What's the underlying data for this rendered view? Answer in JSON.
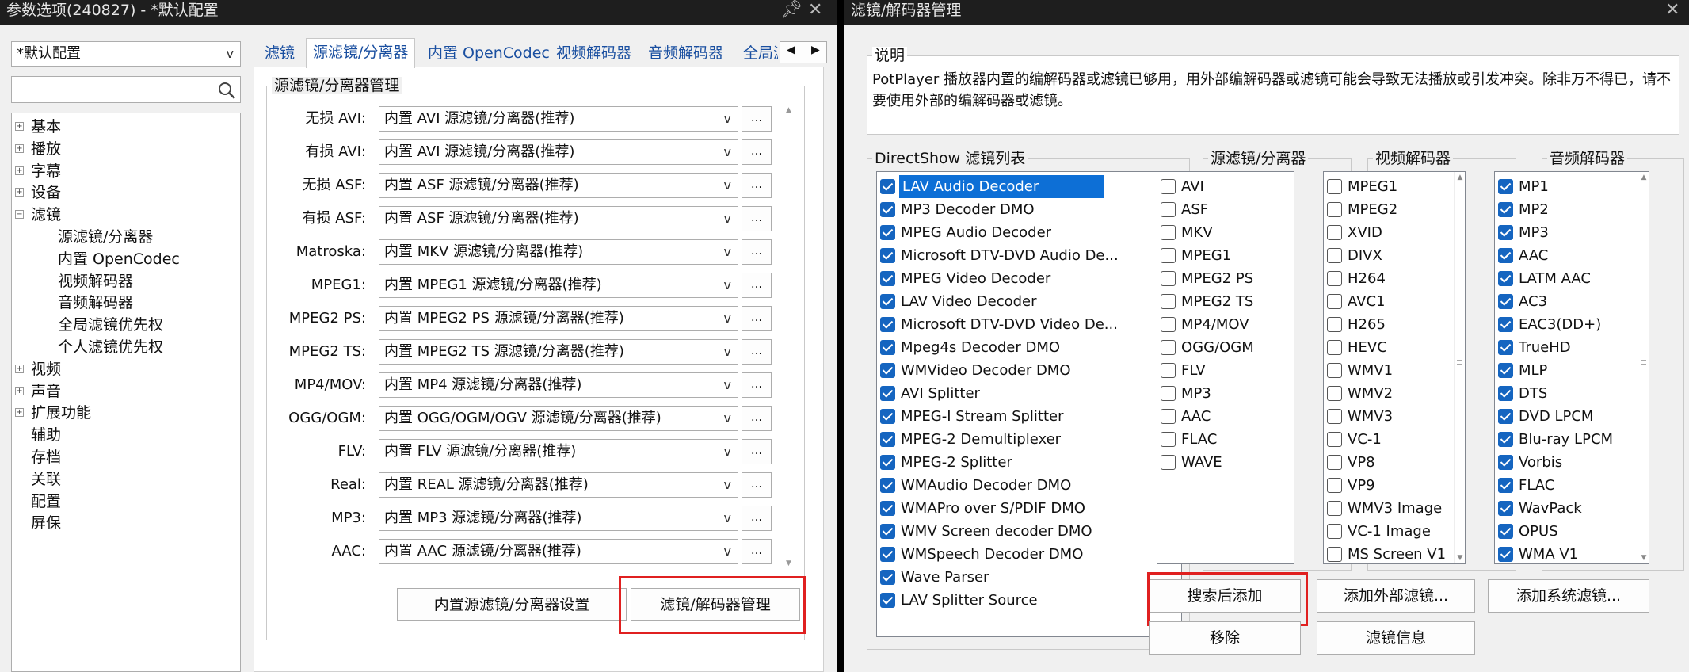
{
  "left_window": {
    "title": "参数选项(240827) - *默认配置",
    "profile_combo": "*默认配置",
    "search_placeholder": "",
    "tree": [
      {
        "label": "基本",
        "level": 0,
        "expander": "+"
      },
      {
        "label": "播放",
        "level": 0,
        "expander": "+"
      },
      {
        "label": "字幕",
        "level": 0,
        "expander": "+"
      },
      {
        "label": "设备",
        "level": 0,
        "expander": "+"
      },
      {
        "label": "滤镜",
        "level": 0,
        "expander": "−"
      },
      {
        "label": "源滤镜/分离器",
        "level": 1,
        "expander": ""
      },
      {
        "label": "内置 OpenCodec",
        "level": 1,
        "expander": ""
      },
      {
        "label": "视频解码器",
        "level": 1,
        "expander": ""
      },
      {
        "label": "音频解码器",
        "level": 1,
        "expander": ""
      },
      {
        "label": "全局滤镜优先权",
        "level": 1,
        "expander": ""
      },
      {
        "label": "个人滤镜优先权",
        "level": 1,
        "expander": ""
      },
      {
        "label": "视频",
        "level": 0,
        "expander": "+"
      },
      {
        "label": "声音",
        "level": 0,
        "expander": "+"
      },
      {
        "label": "扩展功能",
        "level": 0,
        "expander": "+"
      },
      {
        "label": "辅助",
        "level": 0,
        "expander": ""
      },
      {
        "label": "存档",
        "level": 0,
        "expander": ""
      },
      {
        "label": "关联",
        "level": 0,
        "expander": ""
      },
      {
        "label": "配置",
        "level": 0,
        "expander": ""
      },
      {
        "label": "屏保",
        "level": 0,
        "expander": ""
      }
    ],
    "tabs": [
      "滤镜",
      "源滤镜/分离器",
      "内置 OpenCodec",
      "视频解码器",
      "音频解码器",
      "全局滤"
    ],
    "active_tab": 1,
    "group_title": "源滤镜/分离器管理",
    "rows": [
      {
        "label": "无损 AVI:",
        "value": "内置 AVI 源滤镜/分离器(推荐)"
      },
      {
        "label": "有损 AVI:",
        "value": "内置 AVI 源滤镜/分离器(推荐)"
      },
      {
        "label": "无损 ASF:",
        "value": "内置 ASF 源滤镜/分离器(推荐)"
      },
      {
        "label": "有损 ASF:",
        "value": "内置 ASF 源滤镜/分离器(推荐)"
      },
      {
        "label": "Matroska:",
        "value": "内置 MKV 源滤镜/分离器(推荐)"
      },
      {
        "label": "MPEG1:",
        "value": "内置 MPEG1 源滤镜/分离器(推荐)"
      },
      {
        "label": "MPEG2 PS:",
        "value": "内置 MPEG2 PS 源滤镜/分离器(推荐)"
      },
      {
        "label": "MPEG2 TS:",
        "value": "内置 MPEG2 TS 源滤镜/分离器(推荐)"
      },
      {
        "label": "MP4/MOV:",
        "value": "内置 MP4 源滤镜/分离器(推荐)"
      },
      {
        "label": "OGG/OGM:",
        "value": "内置 OGG/OGM/OGV 源滤镜/分离器(推荐)"
      },
      {
        "label": "FLV:",
        "value": "内置 FLV 源滤镜/分离器(推荐)"
      },
      {
        "label": "Real:",
        "value": "内置 REAL 源滤镜/分离器(推荐)"
      },
      {
        "label": "MP3:",
        "value": "内置 MP3 源滤镜/分离器(推荐)"
      },
      {
        "label": "AAC:",
        "value": "内置 AAC 源滤镜/分离器(推荐)"
      }
    ],
    "dots_label": "...",
    "builtin_settings_button": "内置源滤镜/分离器设置",
    "manage_button": "滤镜/解码器管理"
  },
  "right_window": {
    "title": "滤镜/解码器管理",
    "desc_title": "说明",
    "desc_text": "PotPlayer 播放器内置的编解码器或滤镜已够用，用外部编解码器或滤镜可能会导致无法播放或引发冲突。除非万不得已，请不要使用外部的编解码器或滤镜。",
    "ds_title": "DirectShow 滤镜列表",
    "ds_list": [
      {
        "label": "LAV Audio Decoder",
        "checked": true,
        "selected": true
      },
      {
        "label": "MP3 Decoder DMO",
        "checked": true
      },
      {
        "label": "MPEG Audio Decoder",
        "checked": true
      },
      {
        "label": "Microsoft DTV-DVD Audio De...",
        "checked": true
      },
      {
        "label": "MPEG Video Decoder",
        "checked": true
      },
      {
        "label": "LAV Video Decoder",
        "checked": true
      },
      {
        "label": "Microsoft DTV-DVD Video De...",
        "checked": true
      },
      {
        "label": "Mpeg4s Decoder DMO",
        "checked": true
      },
      {
        "label": "WMVideo Decoder DMO",
        "checked": true
      },
      {
        "label": "AVI Splitter",
        "checked": true
      },
      {
        "label": "MPEG-I Stream Splitter",
        "checked": true
      },
      {
        "label": "MPEG-2 Demultiplexer",
        "checked": true
      },
      {
        "label": "MPEG-2 Splitter",
        "checked": true
      },
      {
        "label": "WMAudio Decoder DMO",
        "checked": true
      },
      {
        "label": "WMAPro over S/PDIF DMO",
        "checked": true
      },
      {
        "label": "WMV Screen decoder DMO",
        "checked": true
      },
      {
        "label": "WMSpeech Decoder DMO",
        "checked": true
      },
      {
        "label": "Wave Parser",
        "checked": true
      },
      {
        "label": "LAV Splitter Source",
        "checked": true
      }
    ],
    "src_title": "源滤镜/分离器",
    "src_list": [
      {
        "label": "AVI",
        "checked": false
      },
      {
        "label": "ASF",
        "checked": false
      },
      {
        "label": "MKV",
        "checked": false
      },
      {
        "label": "MPEG1",
        "checked": false
      },
      {
        "label": "MPEG2 PS",
        "checked": false
      },
      {
        "label": "MPEG2 TS",
        "checked": false
      },
      {
        "label": "MP4/MOV",
        "checked": false
      },
      {
        "label": "OGG/OGM",
        "checked": false
      },
      {
        "label": "FLV",
        "checked": false
      },
      {
        "label": "MP3",
        "checked": false
      },
      {
        "label": "AAC",
        "checked": false
      },
      {
        "label": "FLAC",
        "checked": false
      },
      {
        "label": "WAVE",
        "checked": false
      }
    ],
    "vid_title": "视频解码器",
    "vid_list": [
      {
        "label": "MPEG1",
        "checked": false
      },
      {
        "label": "MPEG2",
        "checked": false
      },
      {
        "label": "XVID",
        "checked": false
      },
      {
        "label": "DIVX",
        "checked": false
      },
      {
        "label": "H264",
        "checked": false
      },
      {
        "label": "AVC1",
        "checked": false
      },
      {
        "label": "H265",
        "checked": false
      },
      {
        "label": "HEVC",
        "checked": false
      },
      {
        "label": "WMV1",
        "checked": false
      },
      {
        "label": "WMV2",
        "checked": false
      },
      {
        "label": "WMV3",
        "checked": false
      },
      {
        "label": "VC-1",
        "checked": false
      },
      {
        "label": "VP8",
        "checked": false
      },
      {
        "label": "VP9",
        "checked": false
      },
      {
        "label": "WMV3 Image",
        "checked": false
      },
      {
        "label": "VC-1 Image",
        "checked": false
      },
      {
        "label": "MS Screen V1",
        "checked": false
      }
    ],
    "aud_title": "音频解码器",
    "aud_list": [
      {
        "label": "MP1",
        "checked": true
      },
      {
        "label": "MP2",
        "checked": true
      },
      {
        "label": "MP3",
        "checked": true
      },
      {
        "label": "AAC",
        "checked": true
      },
      {
        "label": "LATM AAC",
        "checked": true
      },
      {
        "label": "AC3",
        "checked": true
      },
      {
        "label": "EAC3(DD+)",
        "checked": true
      },
      {
        "label": "TrueHD",
        "checked": true
      },
      {
        "label": "MLP",
        "checked": true
      },
      {
        "label": "DTS",
        "checked": true
      },
      {
        "label": "DVD LPCM",
        "checked": true
      },
      {
        "label": "Blu-ray LPCM",
        "checked": true
      },
      {
        "label": "Vorbis",
        "checked": true
      },
      {
        "label": "FLAC",
        "checked": true
      },
      {
        "label": "WavPack",
        "checked": true
      },
      {
        "label": "OPUS",
        "checked": true
      },
      {
        "label": "WMA V1",
        "checked": true
      }
    ],
    "btn_search_add": "搜索后添加",
    "btn_add_external": "添加外部滤镜...",
    "btn_add_system": "添加系统滤镜...",
    "btn_remove": "移除",
    "btn_filter_info": "滤镜信息"
  }
}
